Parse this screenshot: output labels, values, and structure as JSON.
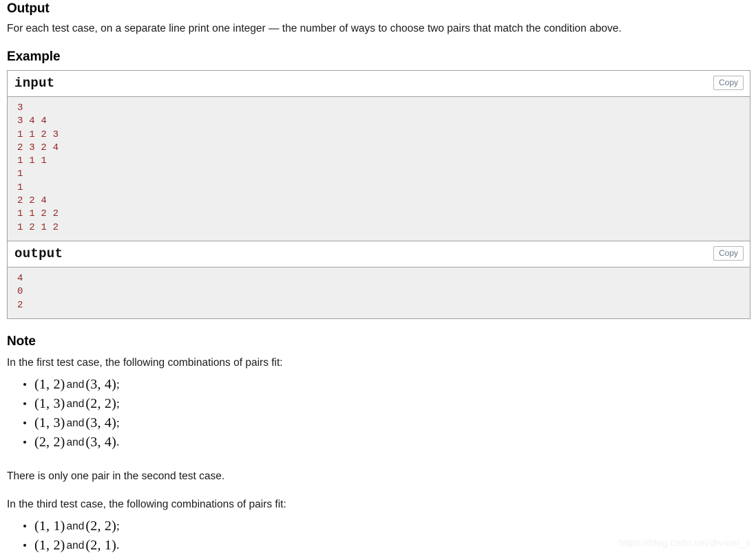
{
  "output_section": {
    "title": "Output",
    "description": "For each test case, on a separate line print one integer — the number of ways to choose two pairs that match the condition above."
  },
  "example_section": {
    "title": "Example",
    "input_block": {
      "label": "input",
      "copy_label": "Copy",
      "content": "3\n3 4 4\n1 1 2 3\n2 3 2 4\n1 1 1\n1\n1\n2 2 4\n1 1 2 2\n1 2 1 2"
    },
    "output_block": {
      "label": "output",
      "copy_label": "Copy",
      "content": "4\n0\n2"
    }
  },
  "note_section": {
    "title": "Note",
    "first_case_intro": "In the first test case, the following combinations of pairs fit:",
    "first_case_items": [
      {
        "left": "(1, 2)",
        "and": "and",
        "right": "(3, 4)",
        "tail": ";"
      },
      {
        "left": "(1, 3)",
        "and": "and",
        "right": "(2, 2)",
        "tail": ";"
      },
      {
        "left": "(1, 3)",
        "and": "and",
        "right": "(3, 4)",
        "tail": ";"
      },
      {
        "left": "(2, 2)",
        "and": "and",
        "right": "(3, 4)",
        "tail": "."
      }
    ],
    "second_case_text": "There is only one pair in the second test case.",
    "third_case_intro": "In the third test case, the following combinations of pairs fit:",
    "third_case_items": [
      {
        "left": "(1, 1)",
        "and": "and",
        "right": "(2, 2)",
        "tail": ";"
      },
      {
        "left": "(1, 2)",
        "and": "and",
        "right": "(2, 1)",
        "tail": "."
      }
    ]
  },
  "watermark": {
    "text": "https://blog.csdn.net/diviner_s"
  }
}
